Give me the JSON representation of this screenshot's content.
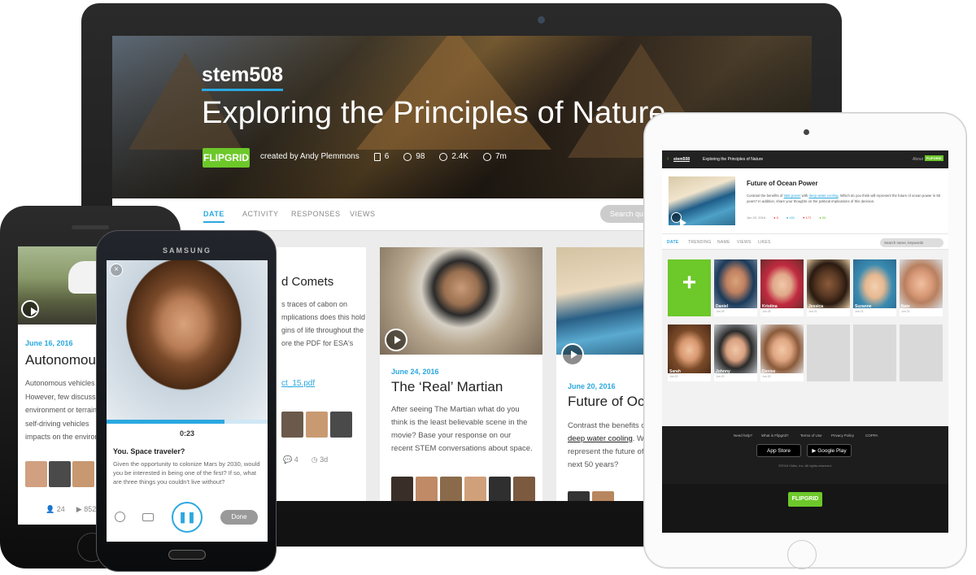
{
  "laptop": {
    "hero": {
      "username": "stem508",
      "title": "Exploring the Principles of Nature",
      "logo": "FLIPGRID",
      "created_by": "created by Andy Plemmons",
      "stats": {
        "topics": "6",
        "members": "98",
        "views": "2.4K",
        "time": "7m"
      }
    },
    "tabs": [
      "DATE",
      "ACTIVITY",
      "RESPONSES",
      "VIEWS"
    ],
    "active_tab": "DATE",
    "search_placeholder": "Search ques",
    "cards": [
      {
        "title": "d Comets",
        "body": "s traces of cabon on\nmplications does this hold\ngins of life throughout the\nore the PDF for ESA's",
        "file": "ct_15.pdf",
        "stats": {
          "comments": "4",
          "age": "3d"
        }
      },
      {
        "date": "June 24, 2016",
        "title": "The ‘Real’ Martian",
        "body": "After seeing The Martian what do you think is the least believable scene in the movie? Base your response on our recent STEM conversations about space."
      },
      {
        "date": "June 20, 2016",
        "title": "Future of Oce",
        "body": "Contrast the benefits of",
        "link1": "deep water cooling",
        "body2": ". Wh",
        "body3": "represent the future of c",
        "body4": "next 50 years?"
      }
    ]
  },
  "ipad": {
    "nav": {
      "back": "stem508",
      "title": "Exploring the Principles of Nature",
      "about": "About",
      "logo": "FLIPGRID"
    },
    "topic": {
      "title": "Future of Ocean Power",
      "body_prefix": "Contrast the benefits of ",
      "link1": "tidal power",
      "body_mid": " with ",
      "link2": "deep water cooling",
      "body_suffix": ". Which do you think will represent the future of ocean power in 50 years? In addition, share your thoughts on the political implications of this decision.",
      "date": "Jun 20, 2016",
      "stats": [
        "8",
        "431",
        "172",
        "56"
      ]
    },
    "tabs": [
      "DATE",
      "TRENDING",
      "NAME",
      "VIEWS",
      "LIKES"
    ],
    "search_placeholder": "Search name, keywords",
    "responses": [
      {
        "name": "Daniel",
        "date": "Jun 25"
      },
      {
        "name": "Kristina",
        "date": "Jun 25"
      },
      {
        "name": "Jessica",
        "date": "Jun 21"
      },
      {
        "name": "Suzanne",
        "date": "Jun 21"
      },
      {
        "name": "Nate",
        "date": "Jun 21"
      },
      {
        "name": "Sarah",
        "date": "Jun 20"
      },
      {
        "name": "Johnny",
        "date": "Jun 20"
      },
      {
        "name": "Denise",
        "date": "Jun 20"
      }
    ],
    "footer": {
      "links": [
        "Need help?",
        "What is Flipgrid?",
        "Terms of Use",
        "Privacy Policy",
        "COPPA"
      ],
      "app_store": "App Store",
      "google_play": "Google Play",
      "copyright": "©2016 Vidku, Inc. All rights reserved.",
      "logo": "FLIPGRID"
    }
  },
  "iphone": {
    "date": "June 16, 2016",
    "title": "Autonomous",
    "body": "Autonomous vehicles a However, few discuss th environment or terrain. on self-driving vehicles impacts on the environ",
    "stats": {
      "members": "24",
      "views": "852"
    }
  },
  "samsung": {
    "brand": "SAMSUNG",
    "time": "0:23",
    "progress_fraction": 0.73,
    "question": "You. Space traveler?",
    "body": "Given the opportunity to colonize Mars by 2030, would you be interested in being one of the first? If so, what are three things you couldn't live without?",
    "done": "Done"
  }
}
